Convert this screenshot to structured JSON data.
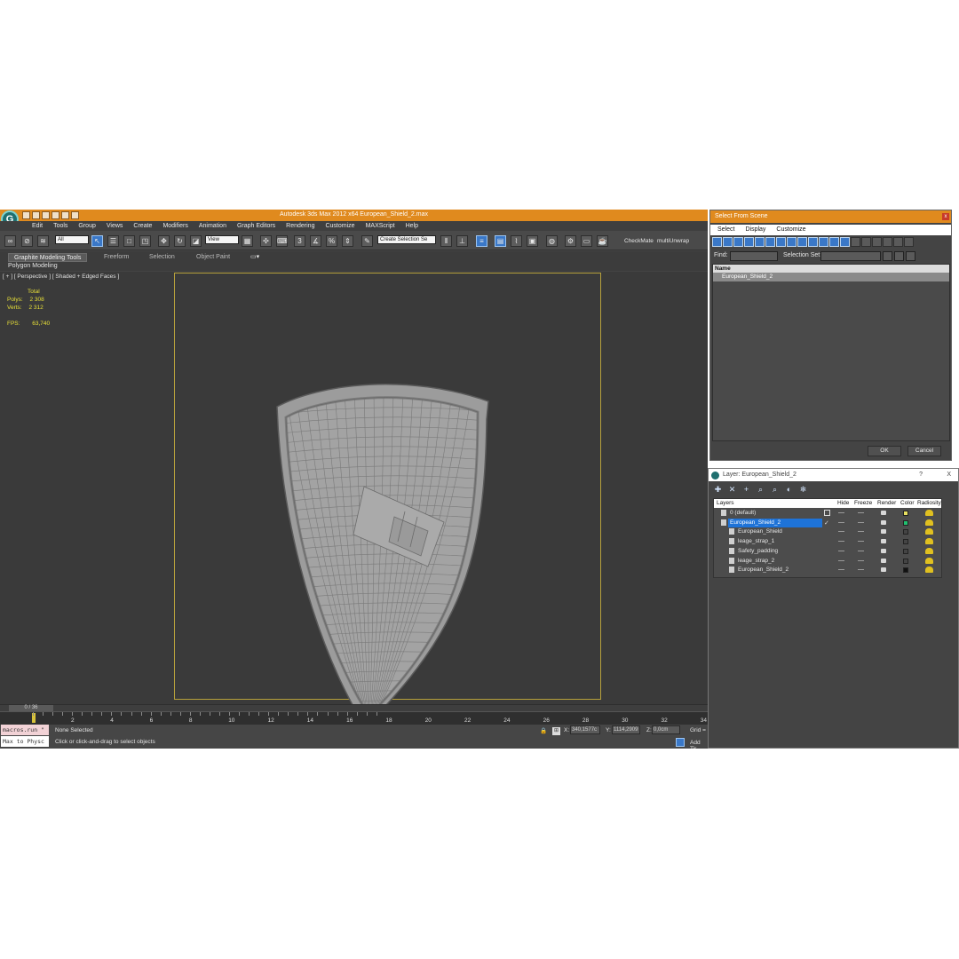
{
  "window": {
    "title": "Autodesk 3ds Max  2012 x64      European_Shield_2.max",
    "logo_icon": "3ds-max-logo-icon"
  },
  "menu": [
    "Edit",
    "Tools",
    "Group",
    "Views",
    "Create",
    "Modifiers",
    "Animation",
    "Graph Editors",
    "Rendering",
    "Customize",
    "MAXScript",
    "Help"
  ],
  "toolbar": {
    "selection_filter": "All",
    "ref_coord": "View",
    "named_selection": "Create Selection Se",
    "checkmate": "CheckMate",
    "multiunwrap": "multiUnwrap"
  },
  "ribbon": {
    "tabs": [
      "Graphite Modeling Tools",
      "Freeform",
      "Selection",
      "Object Paint"
    ],
    "subpanel": "Polygon Modeling"
  },
  "viewport": {
    "label": "[ + ] [ Perspective ] [ Shaded + Edged Faces ]",
    "stats": {
      "total_label": "Total",
      "polys_label": "Polys:",
      "polys": "2 308",
      "verts_label": "Verts:",
      "verts": "2 312",
      "fps_label": "FPS:",
      "fps": "63,740"
    }
  },
  "timeline": {
    "slider": "0 / 36",
    "ticks": [
      "2",
      "4",
      "6",
      "8",
      "10",
      "12",
      "14",
      "16",
      "18",
      "20",
      "22",
      "24",
      "26",
      "28",
      "30",
      "32",
      "34"
    ]
  },
  "status": {
    "listener_top": "macros.run \"",
    "listener_bottom": "Max to Physc",
    "selection": "None Selected",
    "prompt": "Click or click-and-drag to select objects",
    "x_label": "X:",
    "x": "340,1577c",
    "y_label": "Y:",
    "y": "1114,2909",
    "z_label": "Z:",
    "z": "0,0cm",
    "grid": "Grid =",
    "add_time_tag": "Add Tir"
  },
  "select_from_scene": {
    "title": "Select From Scene",
    "menu": [
      "Select",
      "Display",
      "Customize"
    ],
    "find_label": "Find:",
    "selection_set_label": "Selection Set:",
    "column_name": "Name",
    "items": [
      "European_Shield_2"
    ],
    "ok": "OK",
    "cancel": "Cancel"
  },
  "layers": {
    "title": "Layer: European_Shield_2",
    "help": "?",
    "close": "X",
    "columns": {
      "layers": "Layers",
      "hide": "Hide",
      "freeze": "Freeze",
      "render": "Render",
      "color": "Color",
      "radiosity": "Radiosity"
    },
    "rows": [
      {
        "name": "0 (default)",
        "indent": 1,
        "selected": false,
        "color": "#e8e060"
      },
      {
        "name": "European_Shield_2",
        "indent": 1,
        "selected": true,
        "color": "#20c070"
      },
      {
        "name": "European_Shield",
        "indent": 2,
        "selected": false,
        "color": "#444444"
      },
      {
        "name": "leage_strap_1",
        "indent": 2,
        "selected": false,
        "color": "#444444"
      },
      {
        "name": "Safety_padding",
        "indent": 2,
        "selected": false,
        "color": "#444444"
      },
      {
        "name": "leage_strap_2",
        "indent": 2,
        "selected": false,
        "color": "#444444"
      },
      {
        "name": "European_Shield_2",
        "indent": 2,
        "selected": false,
        "color": "#111111"
      }
    ]
  },
  "colors": {
    "title_orange": "#e08a1e",
    "viewport_bg": "#3a3a3a",
    "safe_frame": "#b7a13c",
    "stats_yellow": "#e8e038",
    "selection_blue": "#1e73d8"
  }
}
